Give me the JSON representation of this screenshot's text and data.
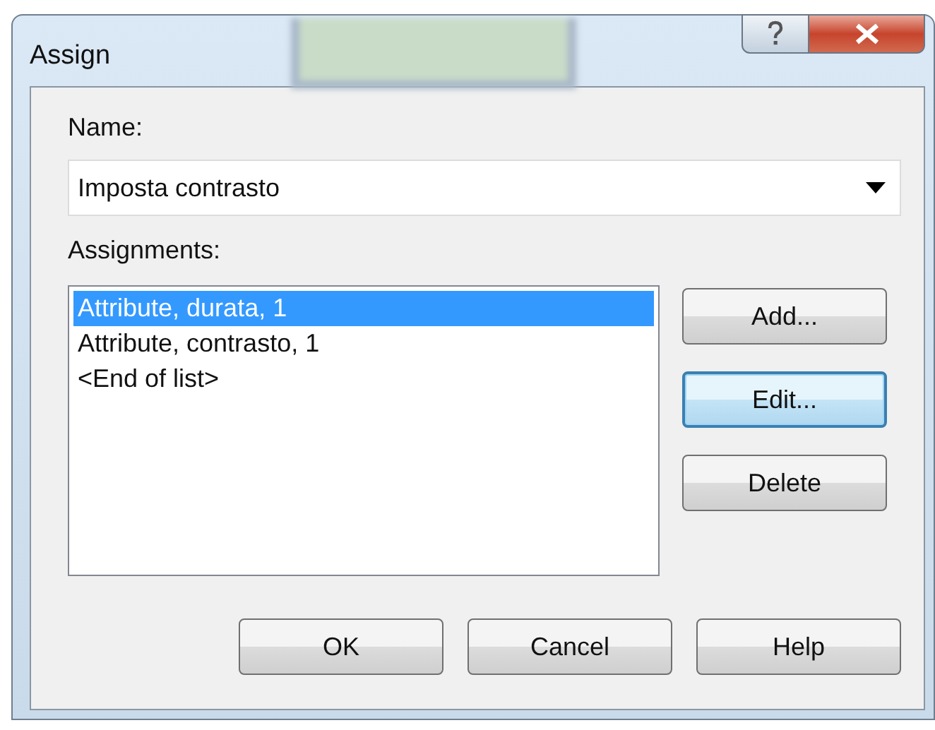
{
  "window": {
    "title": "Assign"
  },
  "name_field": {
    "label": "Name:",
    "value": "Imposta contrasto"
  },
  "assignments": {
    "label": "Assignments:",
    "items": [
      {
        "text": "Attribute, durata, 1",
        "selected": true
      },
      {
        "text": "Attribute, contrasto, 1",
        "selected": false
      },
      {
        "text": "<End of list>",
        "selected": false
      }
    ]
  },
  "side_buttons": [
    {
      "label": "Add...",
      "focused": false
    },
    {
      "label": "Edit...",
      "focused": true
    },
    {
      "label": "Delete",
      "focused": false
    }
  ],
  "buttons": [
    {
      "label": "OK",
      "focused": false
    },
    {
      "label": "Cancel",
      "focused": false
    },
    {
      "label": "Help",
      "focused": false
    }
  ]
}
